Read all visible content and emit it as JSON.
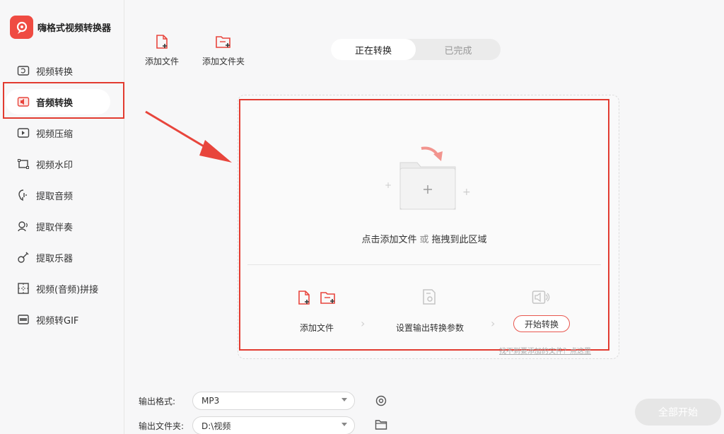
{
  "app": {
    "title": "嗨格式视频转换器",
    "accent": "#e8453c",
    "highlight": "#e23b30"
  },
  "sidebar": {
    "items": [
      {
        "label": "视频转换",
        "icon": "video-convert-icon"
      },
      {
        "label": "音频转换",
        "icon": "audio-convert-icon",
        "active": true
      },
      {
        "label": "视频压缩",
        "icon": "video-compress-icon"
      },
      {
        "label": "视频水印",
        "icon": "video-watermark-icon"
      },
      {
        "label": "提取音频",
        "icon": "extract-audio-icon"
      },
      {
        "label": "提取伴奏",
        "icon": "extract-accompaniment-icon"
      },
      {
        "label": "提取乐器",
        "icon": "extract-instrument-icon"
      },
      {
        "label": "视频(音频)拼接",
        "icon": "merge-icon"
      },
      {
        "label": "视频转GIF",
        "icon": "gif-icon"
      }
    ]
  },
  "toolbar": {
    "add_file": "添加文件",
    "add_folder": "添加文件夹"
  },
  "tabs": [
    {
      "label": "正在转换",
      "active": true
    },
    {
      "label": "已完成",
      "active": false
    }
  ],
  "drop": {
    "hint_click": "点击添加文件",
    "hint_or": "或",
    "hint_drag": "拖拽到此区域",
    "step1": "添加文件",
    "step2": "设置输出转换参数",
    "start": "开始转换",
    "help": "找不到要添加的文件？点这里"
  },
  "output": {
    "format_label": "输出格式:",
    "format_value": "MP3",
    "folder_label": "输出文件夹:",
    "folder_value": "D:\\视频"
  },
  "all_start": "全部开始"
}
